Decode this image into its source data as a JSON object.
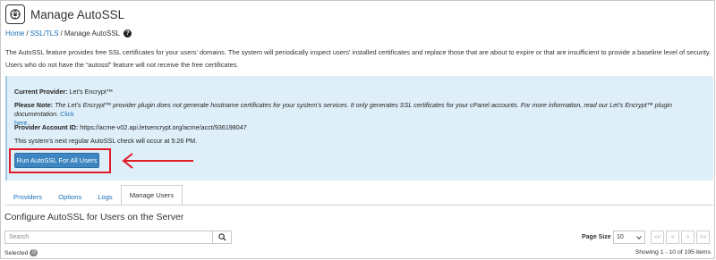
{
  "header": {
    "title": "Manage AutoSSL",
    "logo_icon": "autossl-logo-icon"
  },
  "breadcrumb": {
    "home": "Home",
    "sep1": "/",
    "ssl": "SSL/TLS",
    "sep2": "/",
    "current": "Manage AutoSSL",
    "help": "?"
  },
  "description": {
    "line1": "The AutoSSL feature provides free SSL certificates for your users' domains. The system will periodically inspect users' installed certificates and replace those that are about to expire or that are insufficient to provide a baseline level of security.",
    "line2": "Users who do not have the “autossl” feature will not receive the free certificates."
  },
  "info": {
    "provider_label": "Current Provider:",
    "provider_value": "Let’s Encrypt™",
    "note_label": "Please Note:",
    "note_text": "The Let’s Encrypt™ provider plugin does not generate hostname certificates for your system’s services. It only generates SSL certificates for your cPanel accounts. For more information, read our Let’s Encrypt™ plugin documentation.",
    "note_link_1": "Click",
    "note_link_2": "here.",
    "account_label": "Provider Account ID:",
    "account_value": "https://acme-v02.api.letsencrypt.org/acme/acct/936198047",
    "next_check": "This system’s next regular AutoSSL check will occur at 5:26 PM.",
    "run_button": "Run AutoSSL For All Users"
  },
  "annotation": {
    "color": "#e01b24"
  },
  "tabs": [
    {
      "label": "Providers",
      "active": false
    },
    {
      "label": "Options",
      "active": false
    },
    {
      "label": "Logs",
      "active": false
    },
    {
      "label": "Manage Users",
      "active": true
    }
  ],
  "section": {
    "title": "Configure AutoSSL for Users on the Server"
  },
  "search": {
    "placeholder": "Search",
    "icon": "search-icon"
  },
  "pagination": {
    "page_size_label": "Page Size",
    "page_size_value": "10",
    "first": "<<",
    "prev": "<",
    "next": ">",
    "last": ">>"
  },
  "footer": {
    "selected_label": "Selected",
    "selected_count": "0",
    "showing": "Showing 1 - 10 of 195 items"
  },
  "colors": {
    "accent": "#3e86c2",
    "link": "#1e6fb3",
    "panel": "#dfeff9"
  }
}
